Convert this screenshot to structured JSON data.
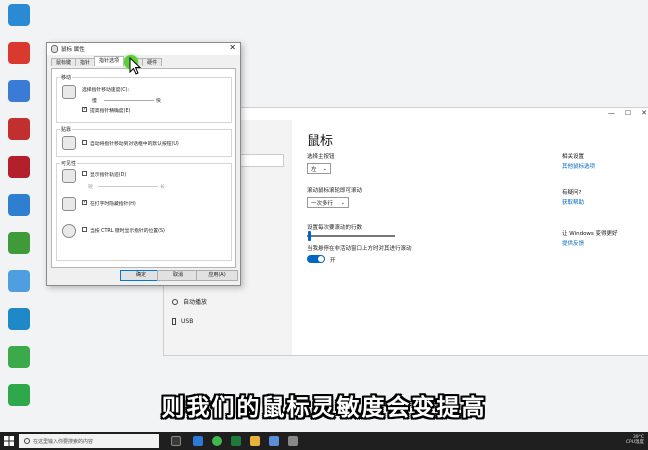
{
  "desktop": {
    "icons": [
      {
        "label": "",
        "color": "#2a8ad4"
      },
      {
        "label": "",
        "color": "#d9392e"
      },
      {
        "label": "",
        "color": "#3a7bd5"
      },
      {
        "label": "",
        "color": "#c22f2f"
      },
      {
        "label": "",
        "color": "#b31f2a"
      },
      {
        "label": "",
        "color": "#2f7fd0"
      },
      {
        "label": "",
        "color": "#3f9a3a"
      },
      {
        "label": "",
        "color": "#4f9fe0"
      },
      {
        "label": "",
        "color": "#1e88c8"
      },
      {
        "label": "",
        "color": "#3caa4a"
      },
      {
        "label": "",
        "color": "#2ea84a"
      }
    ]
  },
  "settings": {
    "title": "鼠标",
    "primary_button_label": "选择主按钮",
    "primary_button_value": "左",
    "scroll_label": "滚动鼠标滚轮即可滚动",
    "scroll_value": "一次多行",
    "lines_label": "设置每次要滚动的行数",
    "inactive_scroll_label": "当我悬停在非活动窗口上方时对其进行滚动",
    "toggle_state": "开",
    "related_title": "相关设置",
    "related_link": "其他鼠标选项",
    "question_title": "有疑问?",
    "help_link": "获取帮助",
    "improve_title": "让 Windows 变得更好",
    "feedback_link": "提供反馈",
    "sidebar_items": [
      {
        "label": "自动播放"
      },
      {
        "label": "USB"
      }
    ],
    "window_controls": {
      "minimize": "—",
      "maximize": "☐",
      "close": "✕"
    }
  },
  "dialog": {
    "title": "鼠标 属性",
    "tabs": [
      "鼠标键",
      "指针",
      "指针选项",
      "滑轮",
      "硬件"
    ],
    "active_tab": 2,
    "motion_group": "移动",
    "speed_label": "选择指针移动速度(C):",
    "slow_label": "慢",
    "fast_label": "快",
    "precision_label": "提高指针精确度(E)",
    "snap_group": "贴靠",
    "snap_label": "自动将指针移动到对话框中的默认按钮(U)",
    "visibility_group": "可见性",
    "trails_label": "显示指针轨迹(D)",
    "short_label": "短",
    "long_label": "长",
    "hide_label": "在打字时隐藏指针(H)",
    "ctrl_label": "当按 CTRL 键时显示指针的位置(S)",
    "ok": "确定",
    "cancel": "取消",
    "apply": "应用(A)",
    "close": "✕"
  },
  "caption": "则我们的鼠标灵敏度会变提高",
  "taskbar": {
    "search_placeholder": "在这里输入你要搜索的内容",
    "temp": "39°C",
    "cpu": "CPU温度"
  }
}
